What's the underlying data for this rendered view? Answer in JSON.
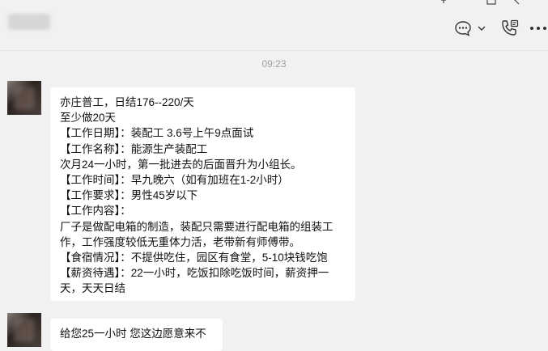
{
  "header": {
    "icons": [
      "pin-icon",
      "window-icon",
      "more-top-icon",
      "chat-bubble-icon",
      "chevron-down-icon",
      "phone-call-icon",
      "more-icon"
    ]
  },
  "chat": {
    "timestamp": "09:23",
    "messages": [
      {
        "lines": [
          "亦庄普工，日结176--220/天",
          "至少做20天",
          "【工作日期】：装配工 3.6号上午9点面试",
          "【工作名称】：能源生产装配工",
          "次月24一小时，第一批进去的后面晋升为小组长。",
          "【工作时间】：早九晚六（如有加班在1-2小时）",
          "【工作要求】：男性45岁以下",
          "【工作内容】：",
          "厂子是做配电箱的制造，装配只需要进行配电箱的组装工",
          "作，工作强度较低无重体力活，老带新有师傅带。",
          "【食宿情况】：不提供吃住，园区有食堂，5-10块钱吃饱",
          "【薪资待遇】：22一小时，吃饭扣除吃饭时间，薪资押一",
          "天，天天日结"
        ]
      },
      {
        "lines": [
          "给您25一小时 您这边愿意来不"
        ]
      }
    ]
  }
}
